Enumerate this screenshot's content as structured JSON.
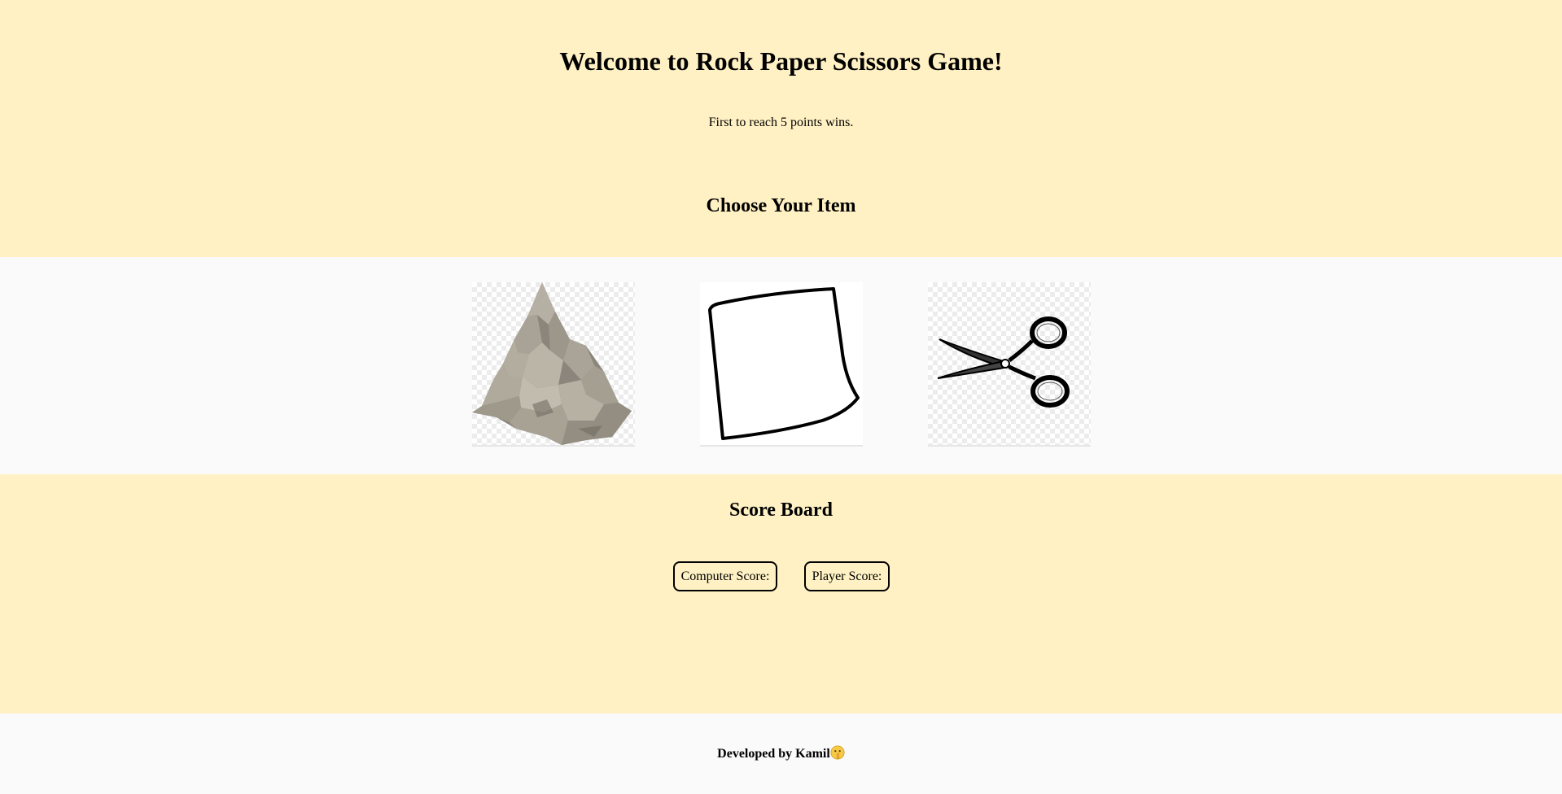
{
  "header": {
    "title": "Welcome to Rock Paper Scissors Game!",
    "subtitle": "First to reach 5 points wins.",
    "choose_heading": "Choose Your Item"
  },
  "choices": [
    {
      "name": "rock",
      "icon": "rock-image"
    },
    {
      "name": "paper",
      "icon": "paper-image"
    },
    {
      "name": "scissors",
      "icon": "scissors-image"
    }
  ],
  "scoreboard": {
    "title": "Score Board",
    "computer_label": "Computer Score:",
    "player_label": "Player Score:"
  },
  "footer": {
    "text": "Developed by Kamil",
    "emoji": "shushing-face-emoji"
  },
  "colors": {
    "accent_background": "#fff1c3",
    "neutral_background": "#fafafa"
  }
}
